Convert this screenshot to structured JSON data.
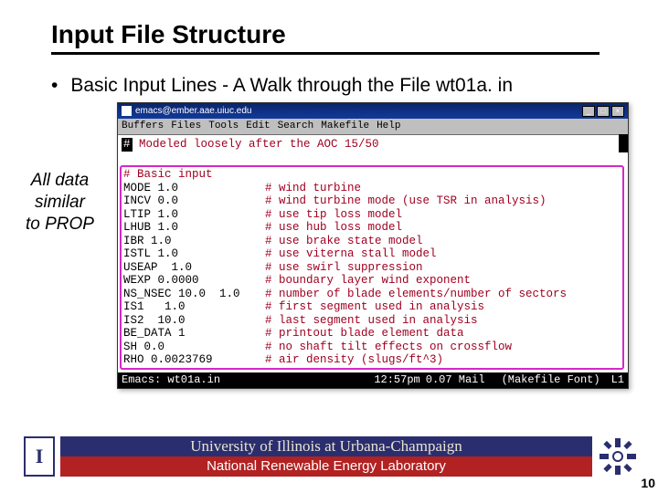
{
  "slide": {
    "title": "Input File Structure",
    "bullet": "Basic Input Lines - A Walk through the File wt01a. in",
    "annotation_l1": "All data",
    "annotation_l2": "similar",
    "annotation_l3": "to PROP"
  },
  "terminal": {
    "titlebar": "emacs@ember.aae.uiuc.edu",
    "win_min": "_",
    "win_max": "□",
    "win_close": "×",
    "menu": [
      "Buffers",
      "Files",
      "Tools",
      "Edit",
      "Search",
      "Makefile",
      "Help"
    ],
    "topline_marker": "#",
    "topline": " Modeled loosely after the AOC 15/50",
    "section_header": "# Basic input",
    "lines": [
      {
        "lhs": "MODE 1.0",
        "rhs": "# wind turbine"
      },
      {
        "lhs": "INCV 0.0",
        "rhs": "# wind turbine mode (use TSR in analysis)"
      },
      {
        "lhs": "LTIP 1.0",
        "rhs": "# use tip loss model"
      },
      {
        "lhs": "LHUB 1.0",
        "rhs": "# use hub loss model"
      },
      {
        "lhs": "IBR 1.0",
        "rhs": "# use brake state model"
      },
      {
        "lhs": "ISTL 1.0",
        "rhs": "# use viterna stall model"
      },
      {
        "lhs": "USEAP  1.0",
        "rhs": "# use swirl suppression"
      },
      {
        "lhs": "WEXP 0.0000",
        "rhs": "# boundary layer wind exponent"
      },
      {
        "lhs": "NS_NSEC 10.0  1.0",
        "rhs": "# number of blade elements/number of sectors"
      },
      {
        "lhs": "IS1   1.0",
        "rhs": "# first segment used in analysis"
      },
      {
        "lhs": "IS2  10.0",
        "rhs": "# last segment used in analysis"
      },
      {
        "lhs": "BE_DATA 1",
        "rhs": "# printout blade element data"
      },
      {
        "lhs": "SH 0.0",
        "rhs": "# no shaft tilt effects on crossflow"
      },
      {
        "lhs": "RHO 0.0023769",
        "rhs": "# air density (slugs/ft^3)"
      }
    ],
    "status": {
      "left": "Emacs: wt01a.in",
      "time": "12:57pm",
      "mid": "0.07 Mail",
      "font": "(Makefile Font)",
      "line": "L1"
    }
  },
  "footer": {
    "logo_left": "I",
    "line1": "University of Illinois at Urbana-Champaign",
    "line2": "National Renewable Energy Laboratory",
    "page": "10"
  }
}
